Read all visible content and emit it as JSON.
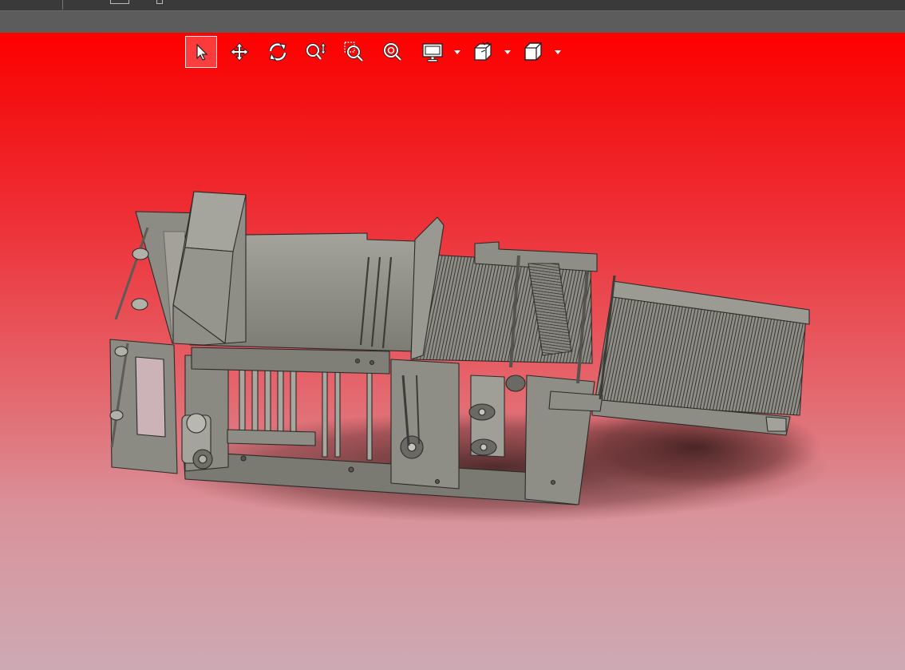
{
  "colors": {
    "viewport_top": "#ff0000",
    "viewport_bottom": "#cdaab4",
    "top_bar": "#3a3a3a",
    "sub_bar": "#5c5c5c",
    "model_fill": "#8f8e86",
    "model_edge": "#2a2a28"
  },
  "toolbar": {
    "tools": [
      {
        "name": "select-tool",
        "icon": "arrow-cursor-icon",
        "active": true
      },
      {
        "name": "pan-tool",
        "icon": "move-arrows-icon",
        "active": false
      },
      {
        "name": "rotate-tool",
        "icon": "rotate-icon",
        "active": false
      },
      {
        "name": "zoom-tool",
        "icon": "zoom-updown-icon",
        "active": false
      },
      {
        "name": "zoom-window-tool",
        "icon": "zoom-window-icon",
        "active": false
      },
      {
        "name": "zoom-fit-tool",
        "icon": "zoom-fit-icon",
        "active": false
      },
      {
        "name": "display-mode-tool",
        "icon": "monitor-icon",
        "has_dropdown": true
      },
      {
        "name": "section-view-tool",
        "icon": "section-cube-icon",
        "has_dropdown": true
      },
      {
        "name": "standard-views-tool",
        "icon": "cube-icon",
        "has_dropdown": true
      }
    ]
  },
  "viewport": {
    "content": "3d-machine-assembly-model"
  }
}
